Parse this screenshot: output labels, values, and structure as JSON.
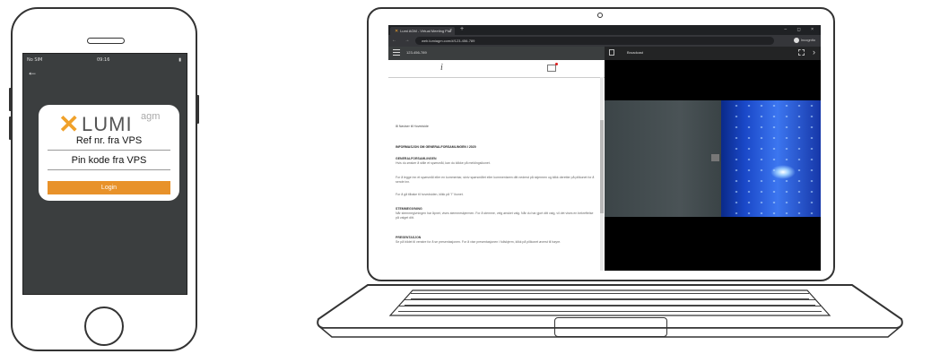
{
  "phone": {
    "status_left": "No SIM",
    "status_center": "09:16",
    "status_right": "▮",
    "back_icon": "back-arrow-icon",
    "logo_word": "LUMI",
    "logo_suffix": "agm",
    "ref_label": "Ref nr. fra VPS",
    "pin_label": "Pin kode fra VPS",
    "login_label": "Login",
    "login_color": "#e8922a",
    "screen_bg": "#3b3e3f"
  },
  "laptop": {
    "tab_title": "Lumi AGM - Virtual Meeting Plat",
    "tab_close": "×",
    "new_tab": "+",
    "window_controls": "– ◻ ×",
    "nav_buttons": "← → C",
    "url": "web.lumiagm.com/#/123-456-789",
    "profile_label": "Incognito",
    "left_header_title": "123-456-789",
    "info_tab_glyph": "i",
    "right_header_title": "Broadcast",
    "next_glyph": "›",
    "document": {
      "link": "Naviser til Hovedside",
      "heading": "INFORMASJON OM GENERALFORSAMLINGEN I 2020",
      "paragraphs": [
        {
          "title": "GENERALFORSAMLINGEN",
          "text": "Hvis du ønsker å stille et spørsmål, kan du klikke på meldingsikonet."
        },
        {
          "title": "",
          "text": "For å legge inn et spørsmål eller en kommentar, skriv spørsmålet eller kommentaren ditt nederst på skjermen og klikk deretter på pilikonet for å sende inn."
        },
        {
          "title": "",
          "text": "For å gå tilbake til hovedsiden, klikk på \"i\" ikonet."
        },
        {
          "title": "STEMMEGIVNING",
          "text": "Når stemmegivningen har åpnet, vises stemmeskjermen. For å stemme, velg ønsket valg. Når du har gjort ditt valg, vil det vises en bekreftelse på valget ditt."
        },
        {
          "title": "PRESENTASJON",
          "text": "Se på bildet til venstre for å se presentasjonen. For å vise presentasjonen i fullskjerm, klikk på pilikonet øverst til høyre."
        }
      ]
    }
  }
}
